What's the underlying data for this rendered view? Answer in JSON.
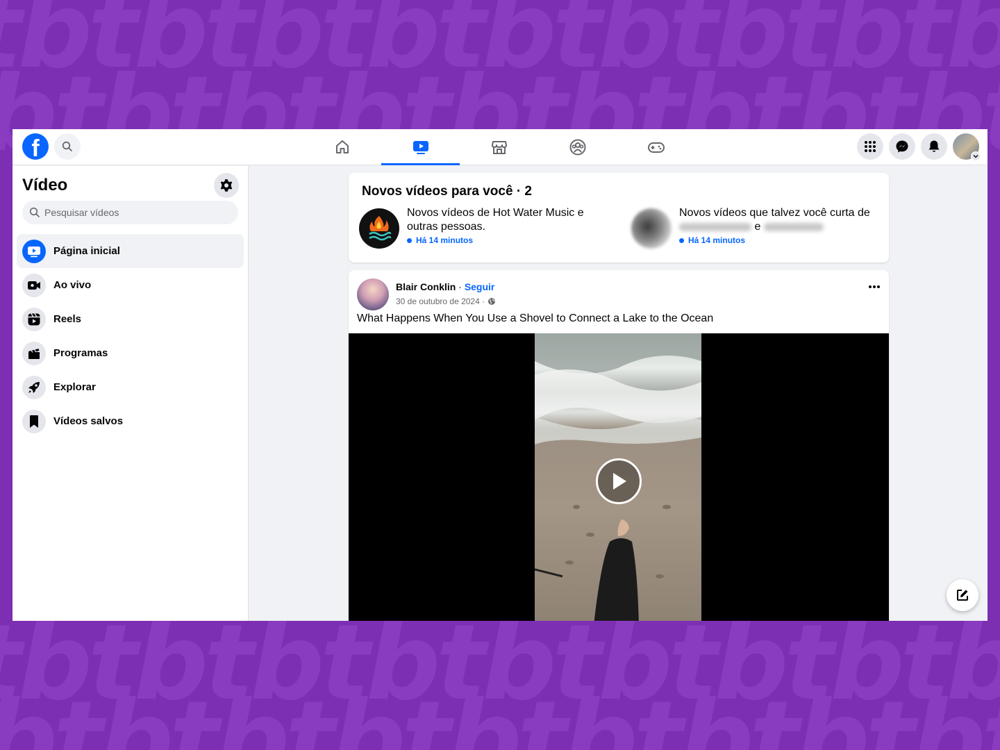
{
  "colors": {
    "brand": "#0866ff",
    "background_purple": "#7d2fb4",
    "text_primary": "#050505",
    "text_secondary": "#65676b"
  },
  "topbar": {
    "logo_icon": "facebook-logo",
    "nav_tabs": [
      {
        "icon": "home-icon",
        "active": false
      },
      {
        "icon": "video-icon",
        "active": true
      },
      {
        "icon": "marketplace-icon",
        "active": false
      },
      {
        "icon": "groups-icon",
        "active": false
      },
      {
        "icon": "gaming-icon",
        "active": false
      }
    ],
    "right_icons": [
      "menu-grid-icon",
      "messenger-icon",
      "notifications-icon",
      "account-avatar"
    ]
  },
  "sidebar": {
    "title": "Vídeo",
    "search_placeholder": "Pesquisar vídeos",
    "items": [
      {
        "label": "Página inicial",
        "icon": "video-home-icon",
        "active": true
      },
      {
        "label": "Ao vivo",
        "icon": "live-icon",
        "active": false
      },
      {
        "label": "Reels",
        "icon": "reels-icon",
        "active": false
      },
      {
        "label": "Programas",
        "icon": "clapperboard-icon",
        "active": false
      },
      {
        "label": "Explorar",
        "icon": "rocket-icon",
        "active": false
      },
      {
        "label": "Vídeos salvos",
        "icon": "bookmark-icon",
        "active": false
      }
    ]
  },
  "new_videos": {
    "title": "Novos vídeos para você · 2",
    "items": [
      {
        "text": "Novos vídeos de Hot Water Music e outras pessoas.",
        "time": "Há 14 minutos"
      },
      {
        "text_prefix": "Novos vídeos que talvez você curta de",
        "conjunction": "e",
        "time": "Há 14 minutos"
      }
    ]
  },
  "post": {
    "author": "Blair Conklin",
    "separator": " · ",
    "follow_label": "Seguir",
    "date": "30 de outubro de 2024 ·",
    "caption": "What Happens When You Use a Shovel to Connect a Lake to the Ocean"
  }
}
